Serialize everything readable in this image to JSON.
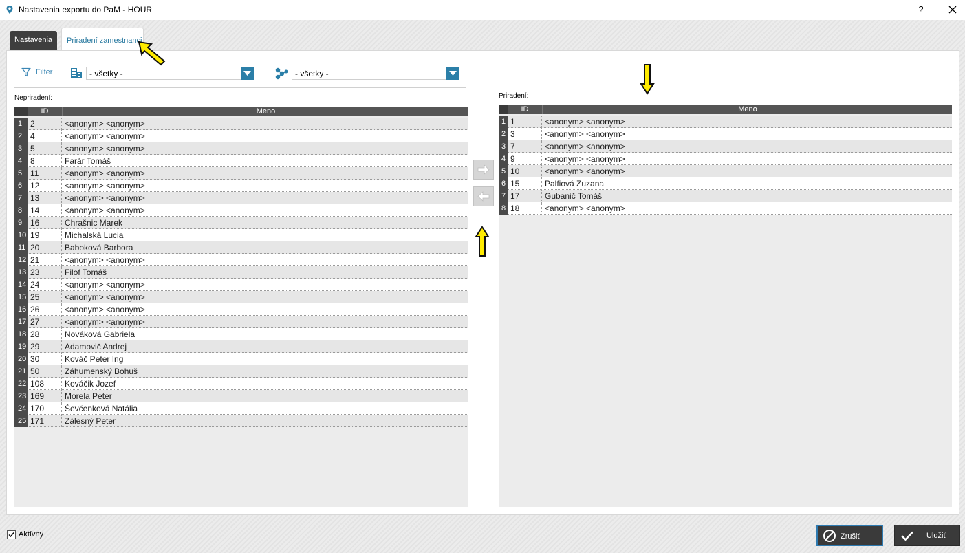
{
  "window": {
    "title": "Nastavenia exportu do PaM - HOUR",
    "help_label": "?"
  },
  "tabs": [
    {
      "label": "Nastavenia"
    },
    {
      "label": "Priradení zamestnanci"
    }
  ],
  "toolbar": {
    "filter_label": "Filter",
    "combo1_value": "- všetky -",
    "combo2_value": "- všetky -"
  },
  "left_grid": {
    "label": "Nepriradení:",
    "col_id": "ID",
    "col_name": "Meno",
    "rows": [
      {
        "n": "1",
        "id": "2",
        "name": "<anonym> <anonym>"
      },
      {
        "n": "2",
        "id": "4",
        "name": "<anonym> <anonym>"
      },
      {
        "n": "3",
        "id": "5",
        "name": "<anonym> <anonym>"
      },
      {
        "n": "4",
        "id": "8",
        "name": "Farár Tomáš"
      },
      {
        "n": "5",
        "id": "11",
        "name": "<anonym> <anonym>"
      },
      {
        "n": "6",
        "id": "12",
        "name": "<anonym> <anonym>"
      },
      {
        "n": "7",
        "id": "13",
        "name": "<anonym> <anonym>"
      },
      {
        "n": "8",
        "id": "14",
        "name": "<anonym> <anonym>"
      },
      {
        "n": "9",
        "id": "16",
        "name": "Chrašnic Marek"
      },
      {
        "n": "10",
        "id": "19",
        "name": "Michalská Lucia"
      },
      {
        "n": "11",
        "id": "20",
        "name": "Baboková Barbora"
      },
      {
        "n": "12",
        "id": "21",
        "name": "<anonym> <anonym>"
      },
      {
        "n": "13",
        "id": "23",
        "name": "Filof Tomáš"
      },
      {
        "n": "14",
        "id": "24",
        "name": "<anonym> <anonym>"
      },
      {
        "n": "15",
        "id": "25",
        "name": "<anonym> <anonym>"
      },
      {
        "n": "16",
        "id": "26",
        "name": "<anonym> <anonym>"
      },
      {
        "n": "17",
        "id": "27",
        "name": "<anonym> <anonym>"
      },
      {
        "n": "18",
        "id": "28",
        "name": "Nováková Gabriela"
      },
      {
        "n": "19",
        "id": "29",
        "name": "Adamovič Andrej"
      },
      {
        "n": "20",
        "id": "30",
        "name": "Kováč Peter Ing"
      },
      {
        "n": "21",
        "id": "50",
        "name": "Záhumenský Bohuš"
      },
      {
        "n": "22",
        "id": "108",
        "name": "Kováčik Jozef"
      },
      {
        "n": "23",
        "id": "169",
        "name": "Morela Peter"
      },
      {
        "n": "24",
        "id": "170",
        "name": "Ševčenková Natália"
      },
      {
        "n": "25",
        "id": "171",
        "name": "Zálesný Peter"
      }
    ]
  },
  "right_grid": {
    "label": "Priradení:",
    "col_id": "ID",
    "col_name": "Meno",
    "rows": [
      {
        "n": "1",
        "id": "1",
        "name": "<anonym> <anonym>"
      },
      {
        "n": "2",
        "id": "3",
        "name": "<anonym> <anonym>"
      },
      {
        "n": "3",
        "id": "7",
        "name": "<anonym> <anonym>"
      },
      {
        "n": "4",
        "id": "9",
        "name": "<anonym> <anonym>"
      },
      {
        "n": "5",
        "id": "10",
        "name": "<anonym> <anonym>"
      },
      {
        "n": "6",
        "id": "15",
        "name": "Palfiová Zuzana"
      },
      {
        "n": "7",
        "id": "17",
        "name": "Gubanič Tomáš"
      },
      {
        "n": "8",
        "id": "18",
        "name": "<anonym> <anonym>"
      }
    ]
  },
  "footer": {
    "active_label": "Aktívny",
    "active_checked": true,
    "cancel_label": "Zrušiť",
    "save_label": "Uložiť"
  },
  "colors": {
    "accent": "#2b7fa8",
    "tab_dark": "#3e3e3e",
    "annotation_yellow": "#ffeb00"
  }
}
